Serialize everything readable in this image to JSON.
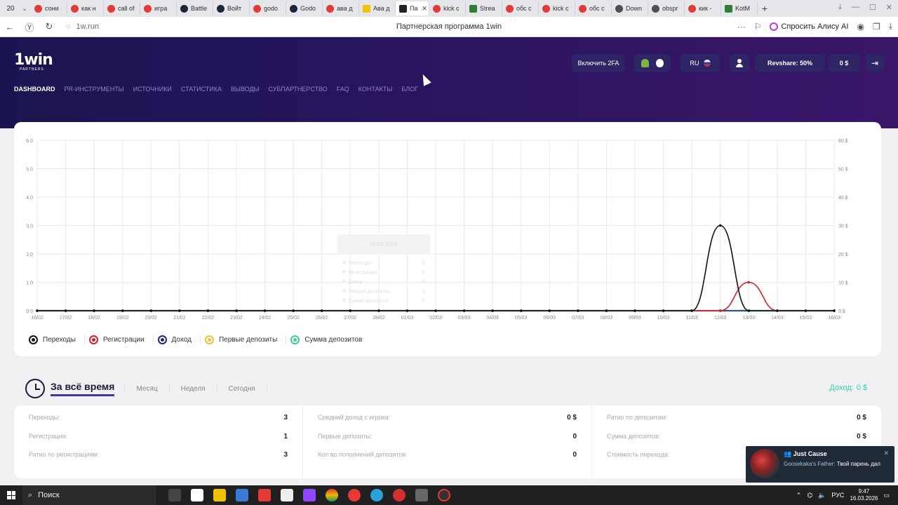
{
  "browser": {
    "tab_count": "20",
    "tabs": [
      {
        "label": "сони",
        "fav": "y"
      },
      {
        "label": "как н",
        "fav": "y"
      },
      {
        "label": "call of",
        "fav": "y"
      },
      {
        "label": "игра",
        "fav": "y"
      },
      {
        "label": "Battle",
        "fav": "s"
      },
      {
        "label": "Войт",
        "fav": "s"
      },
      {
        "label": "godo",
        "fav": "y"
      },
      {
        "label": "Godo",
        "fav": "s"
      },
      {
        "label": "ава д",
        "fav": "y"
      },
      {
        "label": "Ава д",
        "fav": "p"
      },
      {
        "label": "Па",
        "fav": "k",
        "active": true
      },
      {
        "label": "kick c",
        "fav": "y"
      },
      {
        "label": "Strea",
        "fav": "g"
      },
      {
        "label": "обс с",
        "fav": "y"
      },
      {
        "label": "kick c",
        "fav": "y"
      },
      {
        "label": "обс с",
        "fav": "y"
      },
      {
        "label": "Down",
        "fav": "d"
      },
      {
        "label": "obspr",
        "fav": "d"
      },
      {
        "label": "кик -",
        "fav": "y"
      },
      {
        "label": "KotM",
        "fav": "g"
      }
    ],
    "url": "1w.run",
    "page_title": "Партнерская программа 1win",
    "alice_label": "Спросить Алису AI"
  },
  "site": {
    "logo": "1win",
    "logo_sub": "PARTNERS",
    "nav": [
      "DASHBOARD",
      "PR-ИНСТРУМЕНТЫ",
      "ИСТОЧНИКИ",
      "СТАТИСТИКА",
      "ВЫВОДЫ",
      "СУБПАРТНЕРСТВО",
      "FAQ",
      "КОНТАКТЫ",
      "БЛОГ"
    ],
    "btn_2fa": "Включить 2FA",
    "lang": "RU",
    "revshare": "Revshare: 50%",
    "balance": "0 $"
  },
  "chart_data": {
    "type": "line",
    "x": [
      "16/02",
      "17/02",
      "18/02",
      "19/02",
      "20/02",
      "21/02",
      "22/02",
      "23/02",
      "24/02",
      "25/02",
      "26/02",
      "27/02",
      "28/02",
      "01/03",
      "02/03",
      "03/03",
      "04/03",
      "05/03",
      "06/03",
      "07/03",
      "08/03",
      "09/03",
      "10/03",
      "11/03",
      "12/03",
      "13/03",
      "14/03",
      "15/03",
      "16/03"
    ],
    "y_left_ticks": [
      "0.0",
      "1.0",
      "2.0",
      "3.0",
      "4.0",
      "5.0",
      "6.0"
    ],
    "y_right_ticks": [
      "0 $",
      "10 $",
      "20 $",
      "30 $",
      "40 $",
      "50 $",
      "60 $"
    ],
    "ylim": [
      0,
      6
    ],
    "series": [
      {
        "name": "Переходы",
        "color": "#111111",
        "values": [
          0,
          0,
          0,
          0,
          0,
          0,
          0,
          0,
          0,
          0,
          0,
          0,
          0,
          0,
          0,
          0,
          0,
          0,
          0,
          0,
          0,
          0,
          0,
          0,
          3,
          0,
          0,
          0,
          0
        ]
      },
      {
        "name": "Регистрации",
        "color": "#d01f2c",
        "values": [
          0,
          0,
          0,
          0,
          0,
          0,
          0,
          0,
          0,
          0,
          0,
          0,
          0,
          0,
          0,
          0,
          0,
          0,
          0,
          0,
          0,
          0,
          0,
          0,
          0,
          1,
          0,
          0,
          0
        ]
      },
      {
        "name": "Доход",
        "color": "#23237a",
        "values": [
          0,
          0,
          0,
          0,
          0,
          0,
          0,
          0,
          0,
          0,
          0,
          0,
          0,
          0,
          0,
          0,
          0,
          0,
          0,
          0,
          0,
          0,
          0,
          0,
          0,
          0,
          0,
          0,
          0
        ]
      },
      {
        "name": "Первые депозиты",
        "color": "#e8c23a",
        "values": [
          0,
          0,
          0,
          0,
          0,
          0,
          0,
          0,
          0,
          0,
          0,
          0,
          0,
          0,
          0,
          0,
          0,
          0,
          0,
          0,
          0,
          0,
          0,
          0,
          0,
          0,
          0,
          0,
          0
        ]
      },
      {
        "name": "Сумма депозитов",
        "color": "#3ec99a",
        "values": [
          0,
          0,
          0,
          0,
          0,
          0,
          0,
          0,
          0,
          0,
          0,
          0,
          0,
          0,
          0,
          0,
          0,
          0,
          0,
          0,
          0,
          0,
          0,
          0,
          0,
          0,
          0,
          0,
          0
        ]
      }
    ],
    "tooltip": {
      "date": "02.03.2026",
      "rows": [
        {
          "label": "Переходы",
          "value": "0"
        },
        {
          "label": "Регистрации",
          "value": "0"
        },
        {
          "label": "Доход",
          "value": "0"
        },
        {
          "label": "Первые депозиты",
          "value": "0"
        },
        {
          "label": "Сумма депозитов",
          "value": "0"
        }
      ]
    },
    "grid": true,
    "legend": "bottom-left"
  },
  "periods": {
    "active": "За всё время",
    "others": [
      "Месяц",
      "Неделя",
      "Сегодня"
    ],
    "income_label": "Доход:",
    "income_value": "0 $"
  },
  "stats": [
    [
      {
        "label": "Переходы:",
        "value": "3"
      },
      {
        "label": "Регистрации:",
        "value": "1"
      },
      {
        "label": "Ратио по регистрациям:",
        "value": "3"
      }
    ],
    [
      {
        "label": "Средний доход с игрока:",
        "value": "0 $"
      },
      {
        "label": "Первые депозиты:",
        "value": "0"
      },
      {
        "label": "Кол во пополнений депозитов:",
        "value": "0"
      }
    ],
    [
      {
        "label": "Ратио по депозитам:",
        "value": "0 $"
      },
      {
        "label": "Сумма депозитов:",
        "value": "0 $"
      },
      {
        "label": "Стоимость перехода:",
        "value": ""
      }
    ]
  ],
  "notification": {
    "title": "Just Cause",
    "sender": "Goosekaka's Father:",
    "message": "Твой парень дал"
  },
  "taskbar": {
    "search": "Поиск",
    "lang": "РУС",
    "time": "9:47",
    "date": "16.03.2026"
  }
}
